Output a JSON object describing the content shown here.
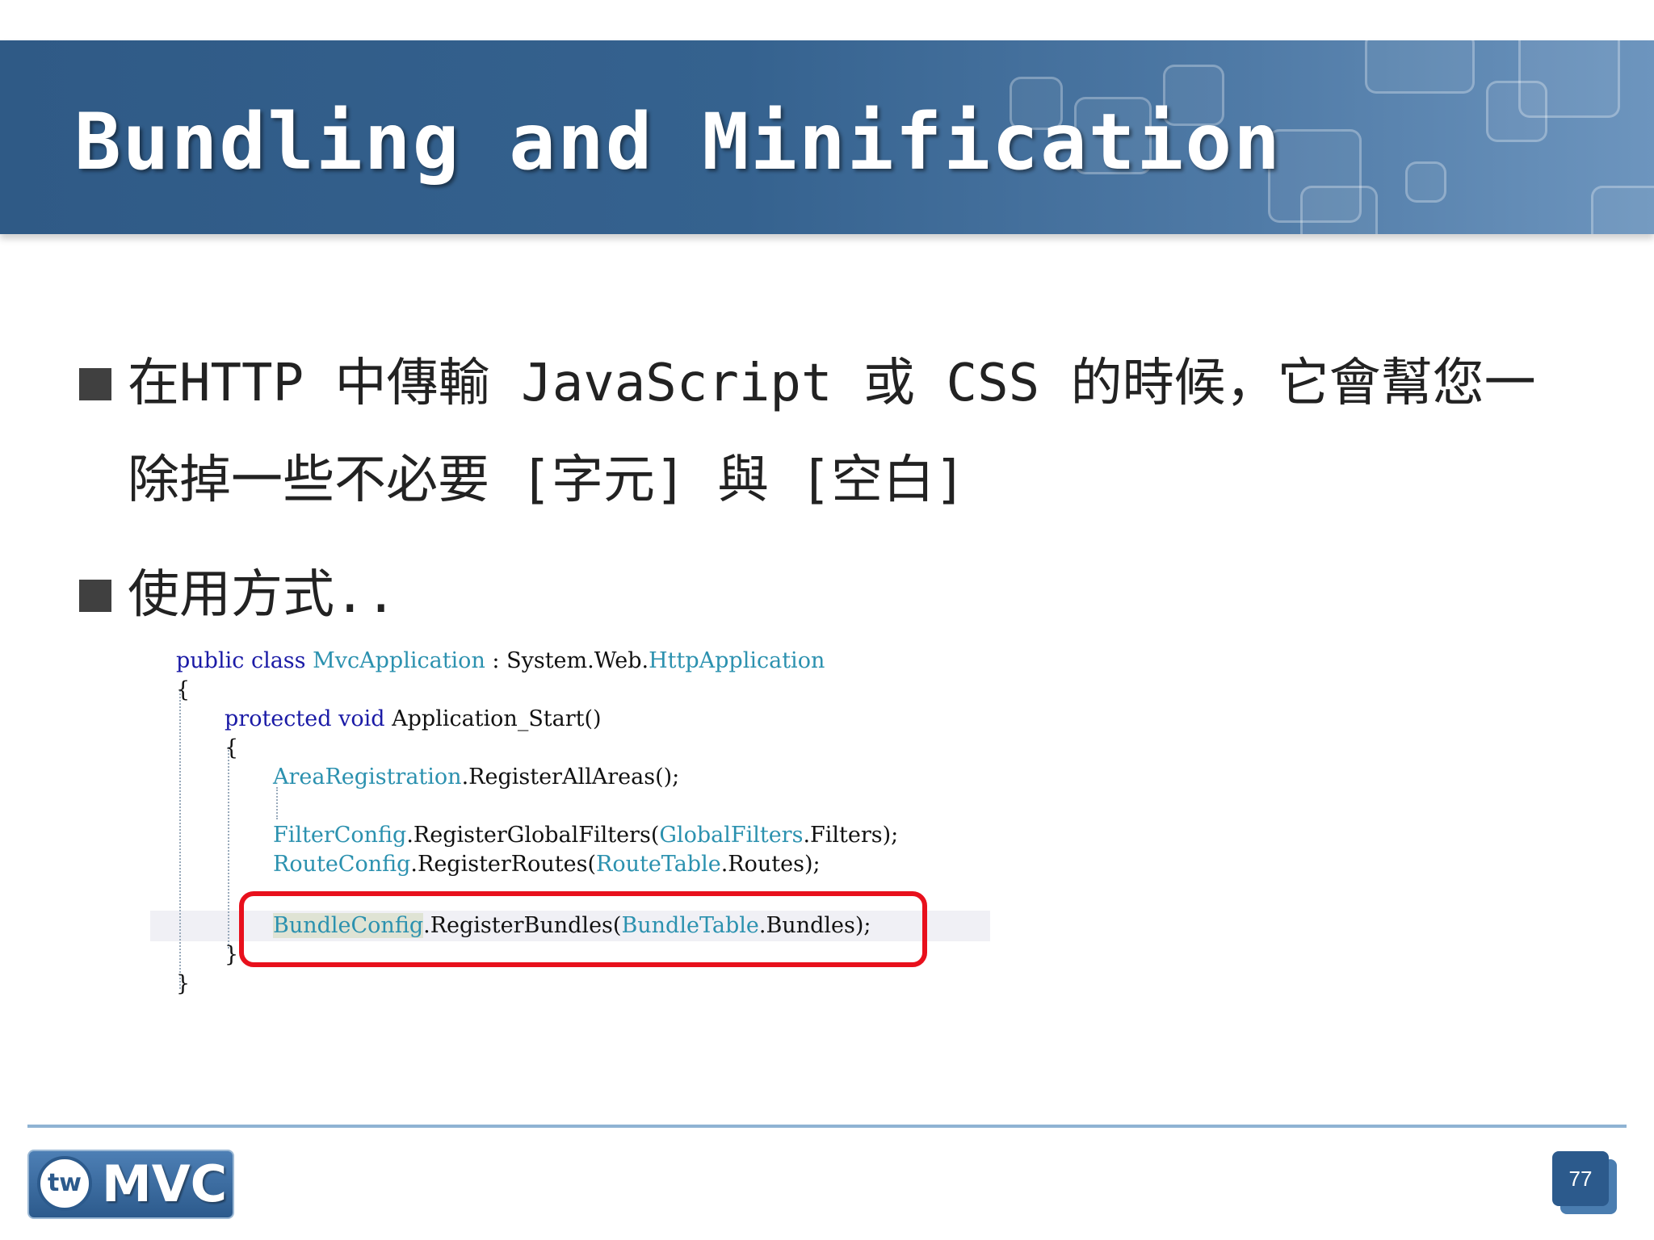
{
  "slide": {
    "title": "Bundling and Minification",
    "bullets": [
      {
        "lines": [
          "在HTTP 中傳輸 JavaScript 或 CSS 的時候，它會幫您一",
          "除掉一些不必要 [字元] 與 [空白]"
        ]
      },
      {
        "lines": [
          "使用方式.."
        ]
      }
    ]
  },
  "code": {
    "l1": {
      "kw1": "public",
      "kw2": "class",
      "type": "MvcApplication",
      "rest": " : System.Web.",
      "type2": "HttpApplication"
    },
    "l2": "{",
    "l3": {
      "kw1": "protected",
      "kw2": "void",
      "rest": " Application_Start()"
    },
    "l4": "{",
    "l5": {
      "type": "AreaRegistration",
      "rest": ".RegisterAllAreas();"
    },
    "l6": {
      "type": "FilterConfig",
      "rest": ".RegisterGlobalFilters(",
      "type2": "GlobalFilters",
      "rest2": ".Filters);"
    },
    "l7": {
      "type": "RouteConfig",
      "rest": ".RegisterRoutes(",
      "type2": "RouteTable",
      "rest2": ".Routes);"
    },
    "l8": {
      "type": "BundleConfig",
      "rest": ".RegisterBundles(",
      "type2": "BundleTable",
      "rest2": ".Bundles);"
    },
    "l9": "}",
    "l10": "}"
  },
  "footer": {
    "logo_circle": "tw",
    "logo_text": "MVC",
    "page_number": "77"
  },
  "colors": {
    "title_bar": "#2f5a86",
    "keyword": "#1a1aa6",
    "type": "#2b91af",
    "highlight_box": "#e8101c"
  }
}
